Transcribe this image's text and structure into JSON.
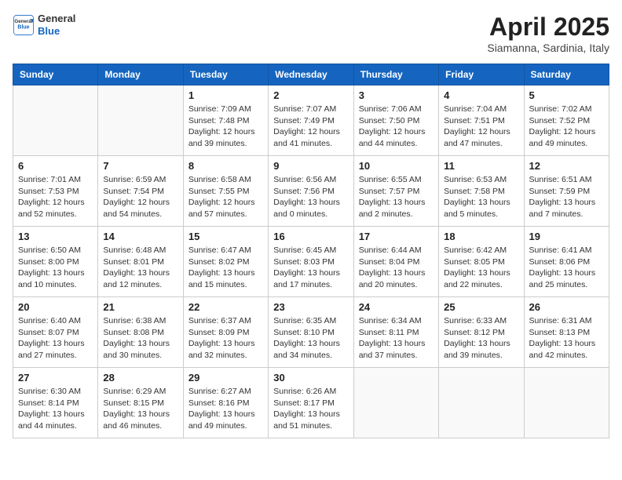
{
  "header": {
    "logo_general": "General",
    "logo_blue": "Blue",
    "month_title": "April 2025",
    "location": "Siamanna, Sardinia, Italy"
  },
  "calendar": {
    "weekdays": [
      "Sunday",
      "Monday",
      "Tuesday",
      "Wednesday",
      "Thursday",
      "Friday",
      "Saturday"
    ],
    "weeks": [
      [
        {
          "day": "",
          "info": ""
        },
        {
          "day": "",
          "info": ""
        },
        {
          "day": "1",
          "info": "Sunrise: 7:09 AM\nSunset: 7:48 PM\nDaylight: 12 hours\nand 39 minutes."
        },
        {
          "day": "2",
          "info": "Sunrise: 7:07 AM\nSunset: 7:49 PM\nDaylight: 12 hours\nand 41 minutes."
        },
        {
          "day": "3",
          "info": "Sunrise: 7:06 AM\nSunset: 7:50 PM\nDaylight: 12 hours\nand 44 minutes."
        },
        {
          "day": "4",
          "info": "Sunrise: 7:04 AM\nSunset: 7:51 PM\nDaylight: 12 hours\nand 47 minutes."
        },
        {
          "day": "5",
          "info": "Sunrise: 7:02 AM\nSunset: 7:52 PM\nDaylight: 12 hours\nand 49 minutes."
        }
      ],
      [
        {
          "day": "6",
          "info": "Sunrise: 7:01 AM\nSunset: 7:53 PM\nDaylight: 12 hours\nand 52 minutes."
        },
        {
          "day": "7",
          "info": "Sunrise: 6:59 AM\nSunset: 7:54 PM\nDaylight: 12 hours\nand 54 minutes."
        },
        {
          "day": "8",
          "info": "Sunrise: 6:58 AM\nSunset: 7:55 PM\nDaylight: 12 hours\nand 57 minutes."
        },
        {
          "day": "9",
          "info": "Sunrise: 6:56 AM\nSunset: 7:56 PM\nDaylight: 13 hours\nand 0 minutes."
        },
        {
          "day": "10",
          "info": "Sunrise: 6:55 AM\nSunset: 7:57 PM\nDaylight: 13 hours\nand 2 minutes."
        },
        {
          "day": "11",
          "info": "Sunrise: 6:53 AM\nSunset: 7:58 PM\nDaylight: 13 hours\nand 5 minutes."
        },
        {
          "day": "12",
          "info": "Sunrise: 6:51 AM\nSunset: 7:59 PM\nDaylight: 13 hours\nand 7 minutes."
        }
      ],
      [
        {
          "day": "13",
          "info": "Sunrise: 6:50 AM\nSunset: 8:00 PM\nDaylight: 13 hours\nand 10 minutes."
        },
        {
          "day": "14",
          "info": "Sunrise: 6:48 AM\nSunset: 8:01 PM\nDaylight: 13 hours\nand 12 minutes."
        },
        {
          "day": "15",
          "info": "Sunrise: 6:47 AM\nSunset: 8:02 PM\nDaylight: 13 hours\nand 15 minutes."
        },
        {
          "day": "16",
          "info": "Sunrise: 6:45 AM\nSunset: 8:03 PM\nDaylight: 13 hours\nand 17 minutes."
        },
        {
          "day": "17",
          "info": "Sunrise: 6:44 AM\nSunset: 8:04 PM\nDaylight: 13 hours\nand 20 minutes."
        },
        {
          "day": "18",
          "info": "Sunrise: 6:42 AM\nSunset: 8:05 PM\nDaylight: 13 hours\nand 22 minutes."
        },
        {
          "day": "19",
          "info": "Sunrise: 6:41 AM\nSunset: 8:06 PM\nDaylight: 13 hours\nand 25 minutes."
        }
      ],
      [
        {
          "day": "20",
          "info": "Sunrise: 6:40 AM\nSunset: 8:07 PM\nDaylight: 13 hours\nand 27 minutes."
        },
        {
          "day": "21",
          "info": "Sunrise: 6:38 AM\nSunset: 8:08 PM\nDaylight: 13 hours\nand 30 minutes."
        },
        {
          "day": "22",
          "info": "Sunrise: 6:37 AM\nSunset: 8:09 PM\nDaylight: 13 hours\nand 32 minutes."
        },
        {
          "day": "23",
          "info": "Sunrise: 6:35 AM\nSunset: 8:10 PM\nDaylight: 13 hours\nand 34 minutes."
        },
        {
          "day": "24",
          "info": "Sunrise: 6:34 AM\nSunset: 8:11 PM\nDaylight: 13 hours\nand 37 minutes."
        },
        {
          "day": "25",
          "info": "Sunrise: 6:33 AM\nSunset: 8:12 PM\nDaylight: 13 hours\nand 39 minutes."
        },
        {
          "day": "26",
          "info": "Sunrise: 6:31 AM\nSunset: 8:13 PM\nDaylight: 13 hours\nand 42 minutes."
        }
      ],
      [
        {
          "day": "27",
          "info": "Sunrise: 6:30 AM\nSunset: 8:14 PM\nDaylight: 13 hours\nand 44 minutes."
        },
        {
          "day": "28",
          "info": "Sunrise: 6:29 AM\nSunset: 8:15 PM\nDaylight: 13 hours\nand 46 minutes."
        },
        {
          "day": "29",
          "info": "Sunrise: 6:27 AM\nSunset: 8:16 PM\nDaylight: 13 hours\nand 49 minutes."
        },
        {
          "day": "30",
          "info": "Sunrise: 6:26 AM\nSunset: 8:17 PM\nDaylight: 13 hours\nand 51 minutes."
        },
        {
          "day": "",
          "info": ""
        },
        {
          "day": "",
          "info": ""
        },
        {
          "day": "",
          "info": ""
        }
      ]
    ]
  }
}
